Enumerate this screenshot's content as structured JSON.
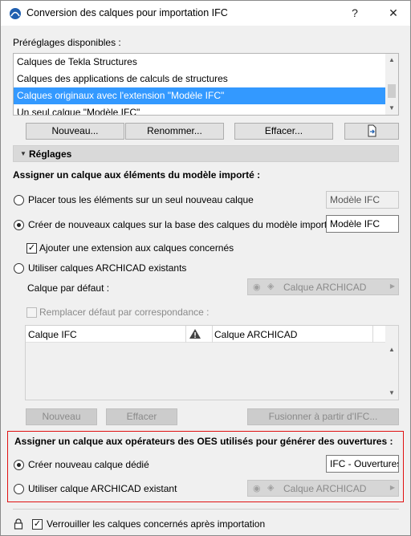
{
  "window": {
    "title": "Conversion des calques pour importation IFC",
    "help_label": "?",
    "close_label": "✕"
  },
  "presets": {
    "label": "Préréglages disponibles :",
    "items": [
      "Calques de Tekla Structures",
      "Calques des applications de calculs de structures",
      "Calques originaux avec l'extension \"Modèle IFC\"",
      "Un seul calque \"Modèle IFC\""
    ],
    "selected_index": 2,
    "buttons": {
      "new": "Nouveau...",
      "rename": "Renommer...",
      "delete": "Effacer..."
    }
  },
  "settings": {
    "header": "Réglages",
    "section1_title": "Assigner un calque aux éléments du modèle importé :",
    "opt_single_layer": "Placer tous les éléments sur un seul nouveau calque",
    "opt_single_layer_value": "Modèle IFC",
    "opt_create_layers": "Créer de nouveaux calques sur la base des calques du modèle importé",
    "opt_create_layers_value": "Modèle IFC",
    "chk_add_extension": "Ajouter une extension aux calques concernés",
    "opt_existing_layers": "Utiliser calques ARCHICAD existants",
    "default_layer_label": "Calque par défaut :",
    "default_layer_value": "Calque ARCHICAD",
    "chk_replace_default": "Remplacer défaut par correspondance :",
    "table": {
      "col_ifc": "Calque IFC",
      "col_archicad": "Calque ARCHICAD"
    },
    "buttons": {
      "new": "Nouveau",
      "delete": "Effacer",
      "merge": "Fusionner à partir d'IFC..."
    },
    "selected_option": "create_layers"
  },
  "openings": {
    "title": "Assigner un calque aux opérateurs des OES utilisés pour générer des ouvertures :",
    "opt_create": "Créer nouveau calque dédié",
    "opt_create_value": "IFC - Ouvertures",
    "opt_existing": "Utiliser calque ARCHICAD existant",
    "existing_value": "Calque ARCHICAD",
    "selected_option": "create"
  },
  "footer": {
    "lock_label": "Verrouiller les calques concernés après importation",
    "lock_checked": true
  },
  "colors": {
    "selection": "#3399ff",
    "highlight_border": "#e01010"
  }
}
